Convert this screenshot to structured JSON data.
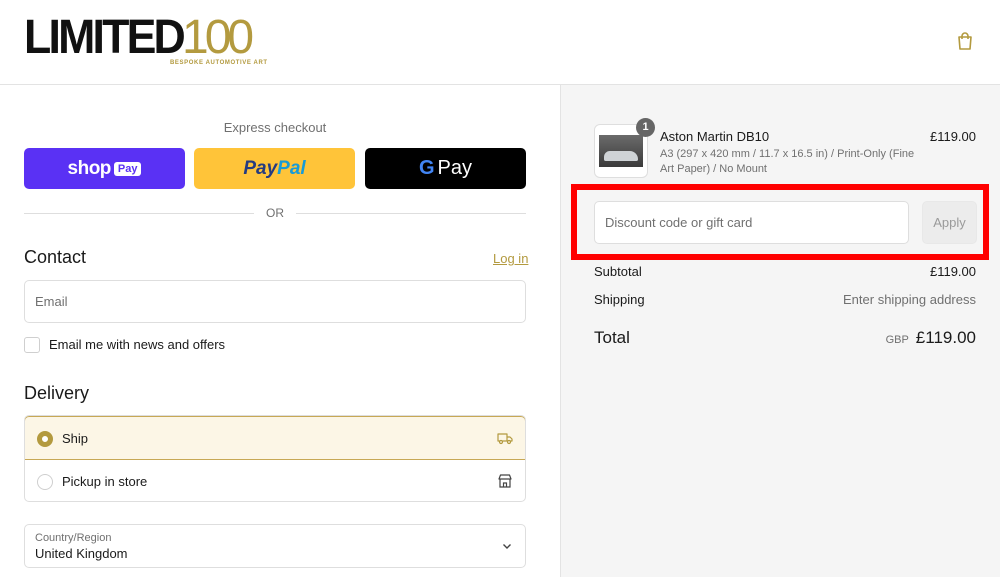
{
  "header": {
    "logo_main": "LIMITED",
    "logo_number": "100",
    "logo_tagline": "BESPOKE AUTOMOTIVE ART"
  },
  "express": {
    "title": "Express checkout",
    "shop_pay_word": "shop",
    "shop_pay_badge": "Pay",
    "paypal_part1": "Pay",
    "paypal_part2": "Pal",
    "gpay_g": "G",
    "gpay_word": "Pay",
    "divider": "OR"
  },
  "contact": {
    "heading": "Contact",
    "login": "Log in",
    "email_placeholder": "Email",
    "newsletter_label": "Email me with news and offers"
  },
  "delivery": {
    "heading": "Delivery",
    "options": [
      {
        "label": "Ship",
        "selected": true
      },
      {
        "label": "Pickup in store",
        "selected": false
      }
    ],
    "country_label": "Country/Region",
    "country_value": "United Kingdom"
  },
  "order": {
    "item": {
      "quantity": "1",
      "name": "Aston Martin DB10",
      "variant": "A3 (297 x 420 mm / 11.7 x 16.5 in) / Print-Only (Fine Art Paper) / No Mount",
      "price": "£119.00"
    },
    "discount_placeholder": "Discount code or gift card",
    "apply_label": "Apply",
    "subtotal_label": "Subtotal",
    "subtotal_value": "£119.00",
    "shipping_label": "Shipping",
    "shipping_value": "Enter shipping address",
    "total_label": "Total",
    "total_currency": "GBP",
    "total_value": "£119.00"
  },
  "colors": {
    "accent_gold": "#b39a3f",
    "shop_pay": "#5a31f4",
    "paypal": "#ffc439",
    "highlight": "#ff0000"
  }
}
